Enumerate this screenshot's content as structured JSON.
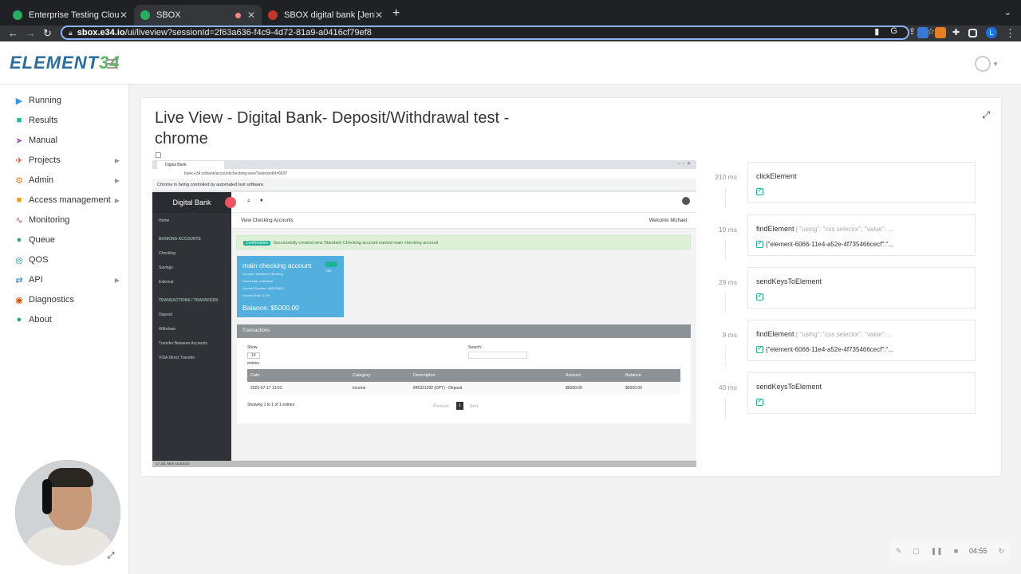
{
  "browser": {
    "tabs": [
      {
        "label": "Enterprise Testing Cloud Behin",
        "favicon_color": "#27ae60"
      },
      {
        "label": "SBOX",
        "favicon_color": "#27ae60"
      },
      {
        "label": "SBOX digital bank [Jenkins]",
        "favicon_color": "#c0392b"
      }
    ],
    "url_host": "sbox.e34.io",
    "url_path": "/ui/liveview?sessionId=2f63a636-f4c9-4d72-81a9-a0416cf79ef8",
    "profile_initial": "L"
  },
  "app": {
    "logo_text_a": "ELEMENT",
    "logo_text_b": "34"
  },
  "sidebar": {
    "items": [
      {
        "label": "Running",
        "icon": "play-icon",
        "color": "#3498db",
        "arrow": false
      },
      {
        "label": "Results",
        "icon": "video-icon",
        "color": "#1abc9c",
        "arrow": false
      },
      {
        "label": "Manual",
        "icon": "cursor-icon",
        "color": "#9b59b6",
        "arrow": false
      },
      {
        "label": "Projects",
        "icon": "plane-icon",
        "color": "#e74c3c",
        "arrow": true
      },
      {
        "label": "Admin",
        "icon": "gear-icon",
        "color": "#e67e22",
        "arrow": true
      },
      {
        "label": "Access management",
        "icon": "lock-icon",
        "color": "#f39c12",
        "arrow": true
      },
      {
        "label": "Monitoring",
        "icon": "pulse-icon",
        "color": "#e74c3c",
        "arrow": false
      },
      {
        "label": "Queue",
        "icon": "users-icon",
        "color": "#27ae60",
        "arrow": false
      },
      {
        "label": "QOS",
        "icon": "dashboard-icon",
        "color": "#16a085",
        "arrow": false
      },
      {
        "label": "API",
        "icon": "exchange-icon",
        "color": "#2980b9",
        "arrow": true
      },
      {
        "label": "Diagnostics",
        "icon": "lifebuoy-icon",
        "color": "#d35400",
        "arrow": false
      },
      {
        "label": "About",
        "icon": "help-icon",
        "color": "#27ae60",
        "arrow": false
      }
    ]
  },
  "main": {
    "title": "Live View - Digital Bank- Deposit/Withdrawal test - chrome"
  },
  "screenshot": {
    "tab_label": "Digital Bank",
    "url": "bank.e34.io/bank/account/checking-view?selectedId=6697",
    "infobar": "Chrome is being controlled by automated test software.",
    "brand": "Digital Bank",
    "nav": {
      "home": "Home",
      "banking_header": "BANKING ACCOUNTS",
      "checking": "Checking",
      "savings": "Savings",
      "external": "External",
      "transactions_header": "TRANSACTIONS / TRANSFERS",
      "deposit": "Deposit",
      "withdraw": "Withdraw",
      "transfer_between": "Transfer Between Accounts",
      "visa_transfer": "VISA Direct Transfer"
    },
    "page_title": "View Checking Accounts",
    "welcome": "Welcome Michael",
    "alert_badge": "Confirmation",
    "alert_text": "Successfully created new Standard Checking account named main checking account",
    "card": {
      "name": "main checking account",
      "toggle": "ON",
      "account": "Account: Standard Checking",
      "ownership": "Ownership: Individual",
      "number": "Account Number: 486133621",
      "interest": "Interest Rate: 0.0%",
      "balance": "Balance: $5000.00"
    },
    "transactions": {
      "header": "Transactions",
      "show_label": "Show",
      "show_value": "10",
      "entries_label": "entries",
      "search_label": "Search:",
      "columns": [
        "Date",
        "Category",
        "Description",
        "Amount",
        "Balance"
      ],
      "rows": [
        [
          "2023-07-17 13:53",
          "Income",
          "845321292 (DPT) - Deposit",
          "$5000.00",
          "$5000.00"
        ]
      ],
      "footer": "Showing 1 to 1 of 1 entries",
      "prev": "Previous",
      "page": "1",
      "next": "Next"
    },
    "status": "17 Jul, Mon 15:53:04"
  },
  "timeline": [
    {
      "ms": "210 ms",
      "command": "clickElement",
      "args": "",
      "result": ""
    },
    {
      "ms": "10 ms",
      "command": "findElement",
      "args": "{ \"using\": \"css selector\", \"value\": ...",
      "result": "{\"element-6066-11e4-a52e-4f735466cecf\":\"..."
    },
    {
      "ms": "29 ms",
      "command": "sendKeysToElement",
      "args": "",
      "result": ""
    },
    {
      "ms": "9 ms",
      "command": "findElement",
      "args": "{ \"using\": \"css selector\", \"value\": ...",
      "result": "{\"element-6066-11e4-a52e-4f735466cecf\":\"..."
    },
    {
      "ms": "40 ms",
      "command": "sendKeysToElement",
      "args": "",
      "result": ""
    }
  ],
  "recorder": {
    "time": "04:55"
  }
}
